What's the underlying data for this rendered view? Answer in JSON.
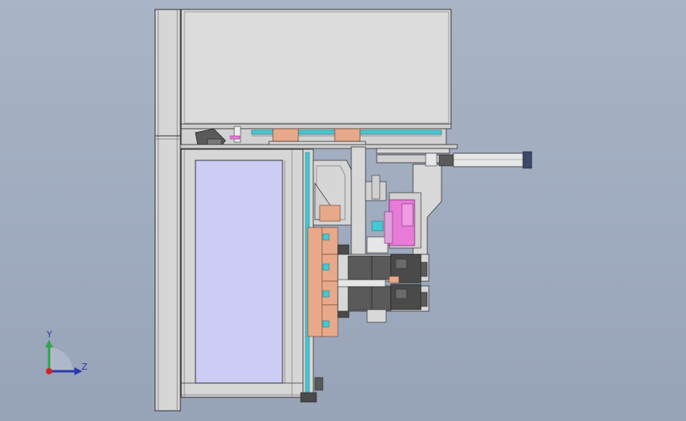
{
  "view": {
    "background_top": "#a9b4c6",
    "background_bottom": "#97a3b8",
    "part_fill": "#d8d8d8",
    "part_stroke": "#3a3a3a",
    "copper_fill": "#e8a98a",
    "cyan_fill": "#43c9d4",
    "magenta_fill": "#e87ad8",
    "glass_fill": "#ccccf5",
    "dark_fill": "#5a5a5a"
  },
  "triad": {
    "y_label": "Y",
    "z_label": "Z",
    "y_color": "#2fa64a",
    "z_color": "#2a3aa8",
    "origin_color": "#d2232a"
  }
}
